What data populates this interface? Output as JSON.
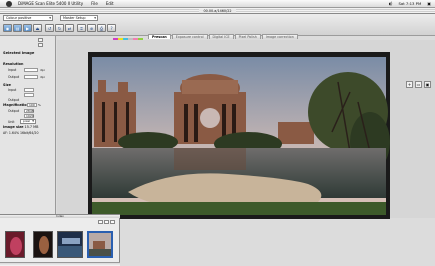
{
  "menubar": {
    "app_name": "DiMAGE Scan Elite 5400 II Utility",
    "file": "File",
    "edit": "Edit",
    "clock": "Sat 7:13 PM"
  },
  "window": {
    "title": "00.00.a/1460/22"
  },
  "toolbar": {
    "job_select": "Colour positive",
    "preset_select": "Master Setup",
    "palette_colors": [
      "#d040c0",
      "#e8e020",
      "#40c0e0",
      "#c0c0c0",
      "#f080b0",
      "#90d040"
    ]
  },
  "tabs": [
    {
      "label": "Prescan",
      "active": true
    },
    {
      "label": "Exposure control",
      "active": false
    },
    {
      "label": "Digital ICE",
      "active": false
    },
    {
      "label": "Pixel Polish",
      "active": false
    },
    {
      "label": "Image correction",
      "active": false
    }
  ],
  "left_panel": {
    "heading": "Selected Image",
    "resolution_label": "Resolution",
    "input_label": "Input",
    "input_unit": "dpi",
    "output_label": "Output",
    "output_unit": "dpi",
    "size_label": "Size",
    "input_size_label": "Input",
    "output_size_label": "Output",
    "magnification_label": "Magnification",
    "magnification_value": "100",
    "magnification_unit": "%",
    "output2_label": "Output",
    "width_value": "2848",
    "height_value": "1920",
    "unit_label": "Unit",
    "unit_value": "pixel",
    "image_size_label": "Image size",
    "image_size_value": "15.7 MB",
    "note": "AF: 1.64% 16bit/64/20"
  },
  "preview": {
    "subject": "Palace of Fine Arts"
  },
  "strip": {
    "label": "Index"
  }
}
